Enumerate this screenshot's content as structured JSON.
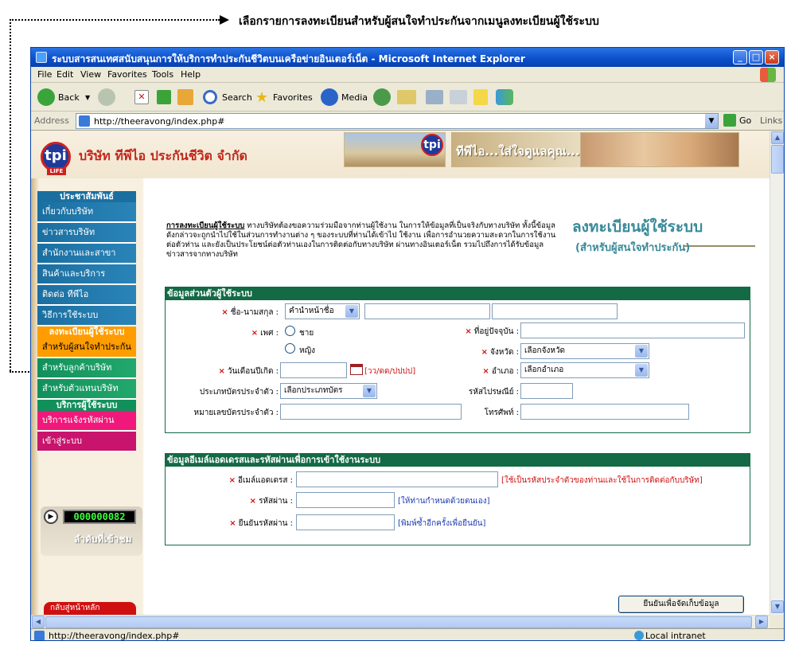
{
  "annotation": {
    "text": "เลือกรายการลงทะเบียนสำหรับผู้สนใจทำประกันจากเมนูลงทะเบียนผู้ใช้ระบบ"
  },
  "window": {
    "title": "ระบบสารสนเทศสนับสนุนการให้บริการทำประกันชีวิตบนเครือข่ายอินเตอร์เน็ต - Microsoft Internet Explorer",
    "buttons": {
      "minimize": "_",
      "maximize": "□",
      "close": "×"
    }
  },
  "menu": [
    "File",
    "Edit",
    "View",
    "Favorites",
    "Tools",
    "Help"
  ],
  "toolbar": {
    "back": "Back",
    "search": "Search",
    "favorites": "Favorites",
    "media": "Media"
  },
  "address": {
    "label": "Address",
    "url": "http://theeravong/index.php#",
    "go": "Go",
    "links": "Links"
  },
  "status": {
    "url": "http://theeravong/index.php#",
    "zone": "Local intranet"
  },
  "page": {
    "company_name": "บริษัท ทีพีไอ ประกันชีวิต จำกัด",
    "logo_text": "tpi",
    "logo_sub": "LIFE",
    "slogan": "ทีพีไอ...ใส่ใจดูแลคุณ...",
    "sidebar": [
      {
        "type": "head",
        "label": "ประชาสัมพันธ์",
        "color": "#1b6fa0"
      },
      {
        "type": "item",
        "label": "เกี่ยวกับบริษัท",
        "style": "sb-blue"
      },
      {
        "type": "item",
        "label": "ข่าวสารบริษัท",
        "style": "sb-blue"
      },
      {
        "type": "item",
        "label": "สำนักงานและสาขา",
        "style": "sb-blue"
      },
      {
        "type": "item",
        "label": "สินค้าและบริการ",
        "style": "sb-blue"
      },
      {
        "type": "item",
        "label": "ติดต่อ ทีพีไอ",
        "style": "sb-blue"
      },
      {
        "type": "item",
        "label": "วิธีการใช้ระบบ",
        "style": "sb-blue"
      },
      {
        "type": "head",
        "label": "ลงทะเบียนผู้ใช้ระบบ",
        "color": "#ff9c00"
      },
      {
        "type": "item",
        "label": "สำหรับผู้สนใจทำประกัน",
        "style": "sb-orange"
      },
      {
        "type": "item",
        "label": "สำหรับลูกค้าบริษัท",
        "style": "sb-green"
      },
      {
        "type": "item",
        "label": "สำหรับตัวแทนบริษัท",
        "style": "sb-green"
      },
      {
        "type": "head",
        "label": "บริการผู้ใช้ระบบ",
        "color": "#12905c"
      },
      {
        "type": "item",
        "label": "บริการแจ้งรหัสผ่าน",
        "style": "sb-pink"
      },
      {
        "type": "item",
        "label": "เข้าสู่ระบบ",
        "style": "sb-magenta"
      }
    ],
    "counter": {
      "digits": "000000082",
      "label": "ลำดับที่เข้าชม"
    },
    "back_home": "กลับสู่หน้าหลัก",
    "intro": {
      "title": "การลงทะเบียนผู้ใช้ระบบ",
      "body": " ทางบริษัทต้องขอความร่วมมือจากท่านผู้ใช้งาน ในการให้ข้อมูลที่เป็นจริงกับทางบริษัท ทั้งนี้ข้อมูลดังกล่าวจะถูกนำไปใช้ในส่วนการทำงานต่าง ๆ ของระบบที่ท่านได้เข้าไป ใช้งาน เพื่อการอำนวยความสะดวกในการใช้งานต่อตัวท่าน และยังเป็นประโยชน์ต่อตัวท่านเองในการติดต่อกับทางบริษัท ผ่านทางอินเตอร์เน็ต รวมไปถึงการได้รับข้อมูล ข่าวสารจากทางบริษัท",
      "right_title": "ลงทะเบียนผู้ใช้ระบบ",
      "right_sub": "(สำหรับผู้สนใจทำประกัน)"
    },
    "personal": {
      "heading": "ข้อมูลส่วนตัวผู้ใช้ระบบ",
      "name_label": "ชื่อ-นามสกุล :",
      "prefix_value": "คำนำหน้าชื่อ",
      "sex_label": "เพศ :",
      "male": "ชาย",
      "female": "หญิง",
      "birth_label": "วันเดือนปีเกิด :",
      "birth_hint": "[วว/ดด/ปปปป]",
      "card_type_label": "ประเภทบัตรประจำตัว :",
      "card_type_value": "เลือกประเภทบัตร",
      "card_no_label": "หมายเลขบัตรประจำตัว :",
      "address_label": "ที่อยู่ปัจจุบัน :",
      "province_label": "จังหวัด :",
      "province_value": "เลือกจังหวัด",
      "district_label": "อำเภอ :",
      "district_value": "เลือกอำเภอ",
      "zip_label": "รหัสไปรษณีย์ :",
      "phone_label": "โทรศัพท์ :"
    },
    "account": {
      "heading": "ข้อมูลอีเมล์แอดเดรสและรหัสผ่านเพื่อการเข้าใช้งานระบบ",
      "email_label": "อีเมล์แอดเดรส :",
      "email_hint": "[ใช้เป็นรหัสประจำตัวของท่านและใช้ในการติดต่อกับบริษัท]",
      "password_label": "รหัสผ่าน :",
      "password_hint": "[ให้ท่านกำหนดด้วยตนเอง]",
      "confirm_label": "ยืนยันรหัสผ่าน :",
      "confirm_hint": "[พิมพ์ซ้ำอีกครั้งเพื่อยืนยัน]"
    },
    "submit": "ยืนยันเพื่อจัดเก็บข้อมูล"
  }
}
